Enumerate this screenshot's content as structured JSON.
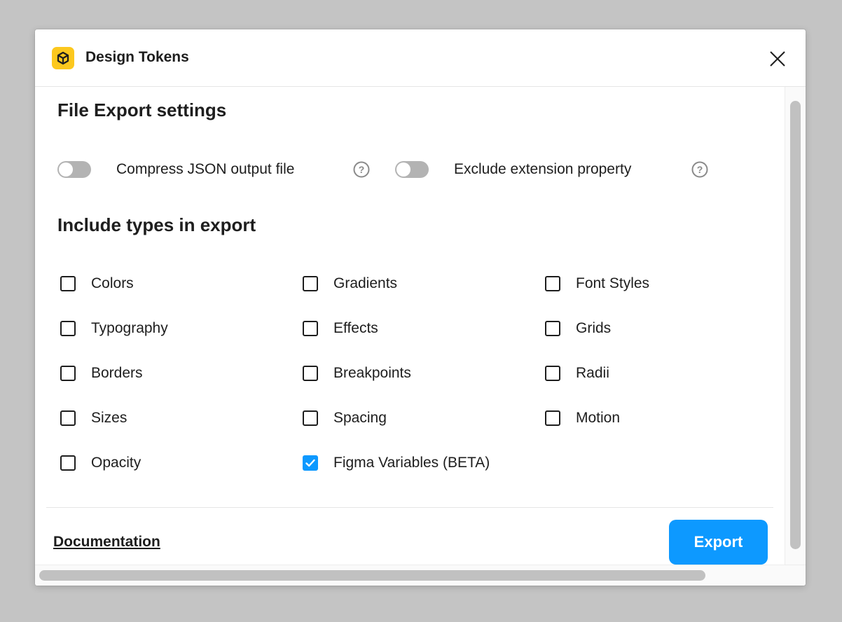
{
  "window": {
    "title": "Design Tokens",
    "app_icon": "design-tokens-cube-icon",
    "close_icon": "close-icon"
  },
  "settings": {
    "heading": "File Export settings",
    "options": [
      {
        "label": "Compress JSON output file",
        "enabled": false,
        "help_icon": "question-circle-icon"
      },
      {
        "label": "Exclude extension property",
        "enabled": false,
        "help_icon": "question-circle-icon"
      }
    ]
  },
  "types": {
    "heading": "Include types in export",
    "items": [
      {
        "label": "Colors",
        "checked": false
      },
      {
        "label": "Gradients",
        "checked": false
      },
      {
        "label": "Font Styles",
        "checked": false
      },
      {
        "label": "Typography",
        "checked": false
      },
      {
        "label": "Effects",
        "checked": false
      },
      {
        "label": "Grids",
        "checked": false
      },
      {
        "label": "Borders",
        "checked": false
      },
      {
        "label": "Breakpoints",
        "checked": false
      },
      {
        "label": "Radii",
        "checked": false
      },
      {
        "label": "Sizes",
        "checked": false
      },
      {
        "label": "Spacing",
        "checked": false
      },
      {
        "label": "Motion",
        "checked": false
      },
      {
        "label": "Opacity",
        "checked": false
      },
      {
        "label": "Figma Variables (BETA)",
        "checked": true
      }
    ]
  },
  "footer": {
    "documentation_link": "Documentation",
    "export_button": "Export"
  },
  "colors": {
    "accent": "#0d99ff",
    "brand_yellow": "#fcc81e",
    "toggle_off": "#b3b3b3"
  }
}
